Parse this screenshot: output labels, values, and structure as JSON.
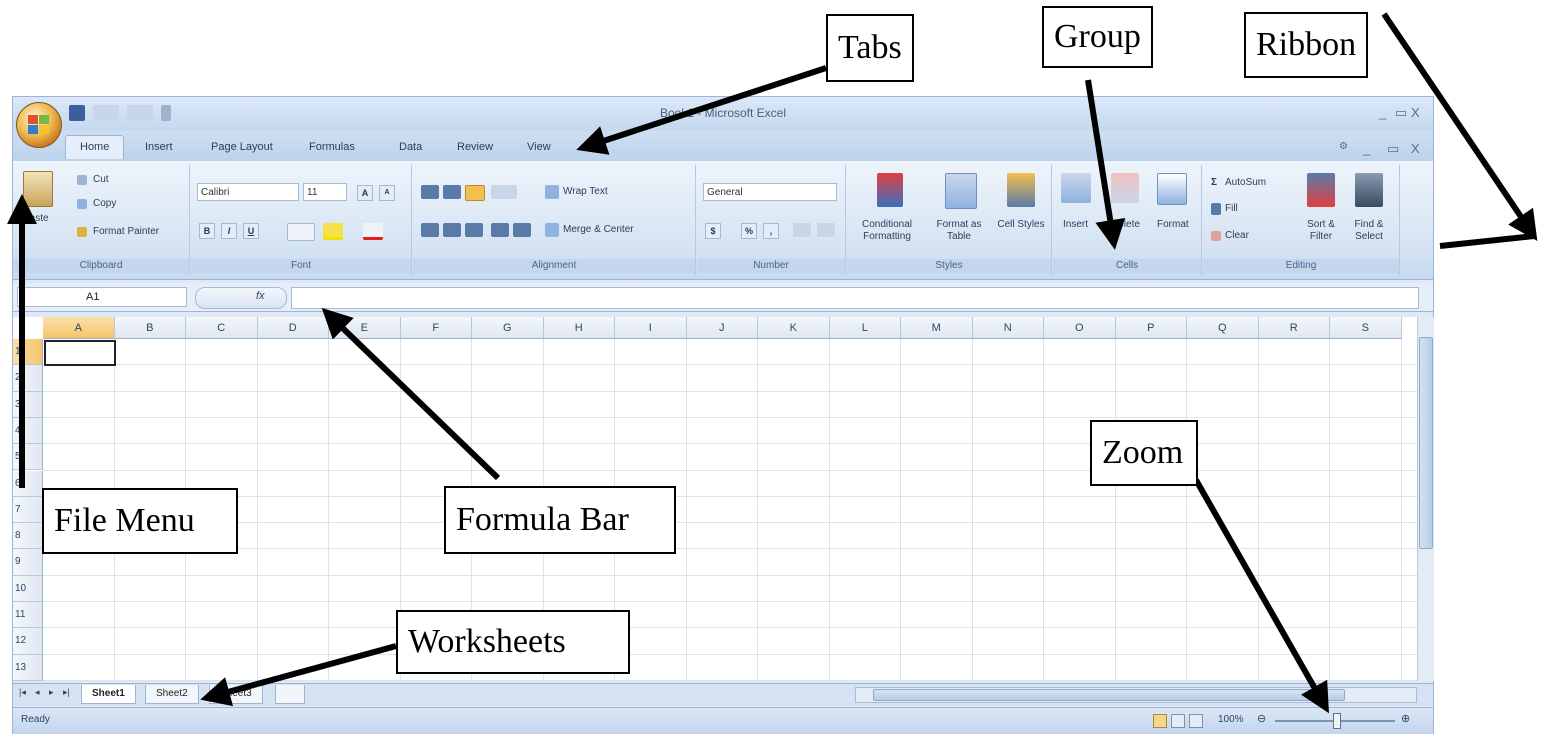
{
  "window": {
    "title": "Book1 - Microsoft Excel",
    "controls": [
      "_",
      "▭",
      "X"
    ],
    "inner_controls": [
      "_",
      "▭",
      "X"
    ]
  },
  "tabs": [
    "Home",
    "Insert",
    "Page Layout",
    "Formulas",
    "Data",
    "Review",
    "View"
  ],
  "active_tab": "Home",
  "ribbon": {
    "clipboard": {
      "label": "Clipboard",
      "paste": "Paste",
      "cut": "Cut",
      "copy": "Copy",
      "format_painter": "Format Painter"
    },
    "font": {
      "label": "Font",
      "font_name": "Calibri",
      "font_size": "11",
      "grow": "A",
      "shrink": "A",
      "bold": "B",
      "italic": "I",
      "underline": "U"
    },
    "alignment": {
      "label": "Alignment",
      "wrap_text": "Wrap Text",
      "merge_center": "Merge & Center"
    },
    "number": {
      "label": "Number",
      "format": "General",
      "currency": "$",
      "percent": "%",
      "comma": ","
    },
    "styles": {
      "label": "Styles",
      "conditional": "Conditional Formatting",
      "format_table": "Format as Table",
      "cell_styles": "Cell Styles"
    },
    "cells": {
      "label": "Cells",
      "insert": "Insert",
      "delete": "Delete",
      "format": "Format"
    },
    "editing": {
      "label": "Editing",
      "autosum": "AutoSum",
      "fill": "Fill",
      "clear": "Clear",
      "sort_filter": "Sort & Filter",
      "find_select": "Find & Select"
    }
  },
  "formula_bar": {
    "name_box": "A1",
    "fx": "fx",
    "value": ""
  },
  "columns": [
    "A",
    "B",
    "C",
    "D",
    "E",
    "F",
    "G",
    "H",
    "I",
    "J",
    "K",
    "L",
    "M",
    "N",
    "O",
    "P",
    "Q",
    "R",
    "S"
  ],
  "rows": [
    "1",
    "2",
    "3",
    "4",
    "5",
    "6",
    "7",
    "8",
    "9",
    "10",
    "11",
    "12",
    "13"
  ],
  "sheets": [
    "Sheet1",
    "Sheet2",
    "Sheet3"
  ],
  "status": {
    "ready": "Ready",
    "zoom": "100%"
  },
  "annotations": {
    "tabs": "Tabs",
    "group": "Group",
    "ribbon": "Ribbon",
    "file_menu": "File Menu",
    "formula_bar": "Formula Bar",
    "zoom": "Zoom",
    "worksheets": "Worksheets"
  }
}
